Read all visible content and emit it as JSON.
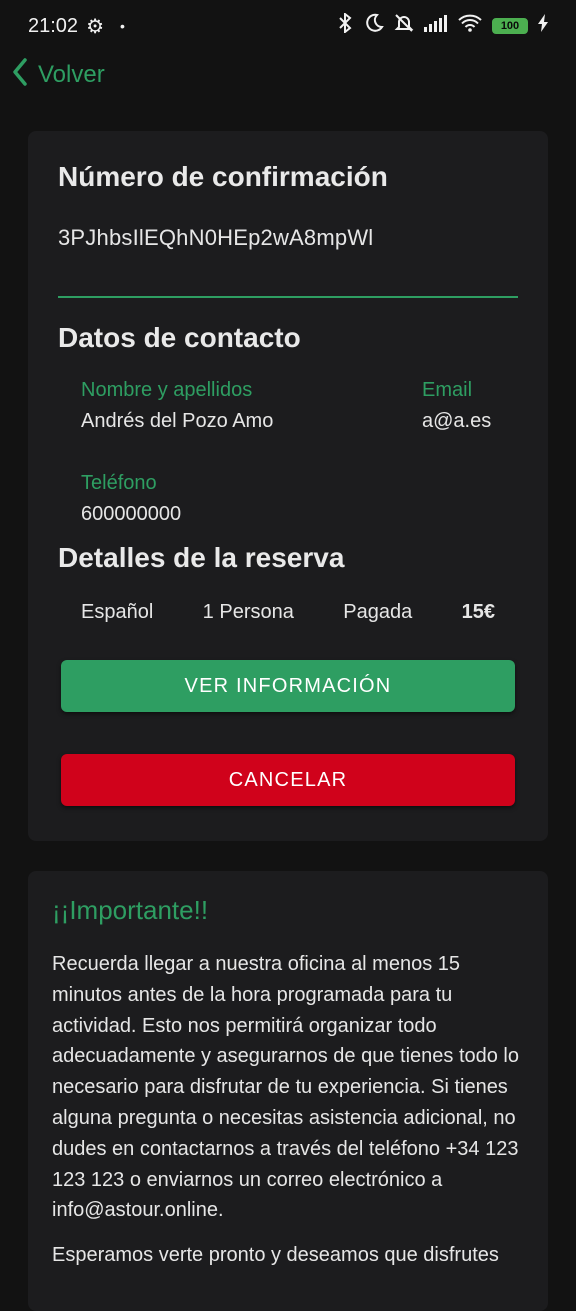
{
  "status_bar": {
    "time": "21:02",
    "battery": "100"
  },
  "nav": {
    "back_label": "Volver"
  },
  "confirmation": {
    "title": "Número de confirmación",
    "code": "3PJhbsIlEQhN0HEp2wA8mpWl"
  },
  "contact": {
    "title": "Datos de contacto",
    "name_label": "Nombre y apellidos",
    "name_value": "Andrés del Pozo Amo",
    "email_label": "Email",
    "email_value": "a@a.es",
    "phone_label": "Teléfono",
    "phone_value": "600000000"
  },
  "booking": {
    "title": "Detalles de la reserva",
    "language": "Español",
    "people": "1 Persona",
    "status": "Pagada",
    "price": "15€"
  },
  "buttons": {
    "info": "VER INFORMACIÓN",
    "cancel": "CANCELAR"
  },
  "important": {
    "title": "¡¡Importante!!",
    "text": "Recuerda llegar a nuestra oficina al menos 15 minutos antes de la hora programada para tu actividad. Esto nos permitirá organizar todo adecuadamente y asegurarnos de que tienes todo lo necesario para disfrutar de tu experiencia. Si tienes alguna pregunta o necesitas asistencia adicional, no dudes en contactarnos a través del teléfono +34 123 123 123 o enviarnos un correo electrónico a info@astour.online.",
    "text2": "Esperamos verte pronto y deseamos que disfrutes"
  },
  "colors": {
    "accent": "#2e9e62",
    "danger": "#d0021b",
    "background": "#121212",
    "card": "#1c1c1e"
  }
}
